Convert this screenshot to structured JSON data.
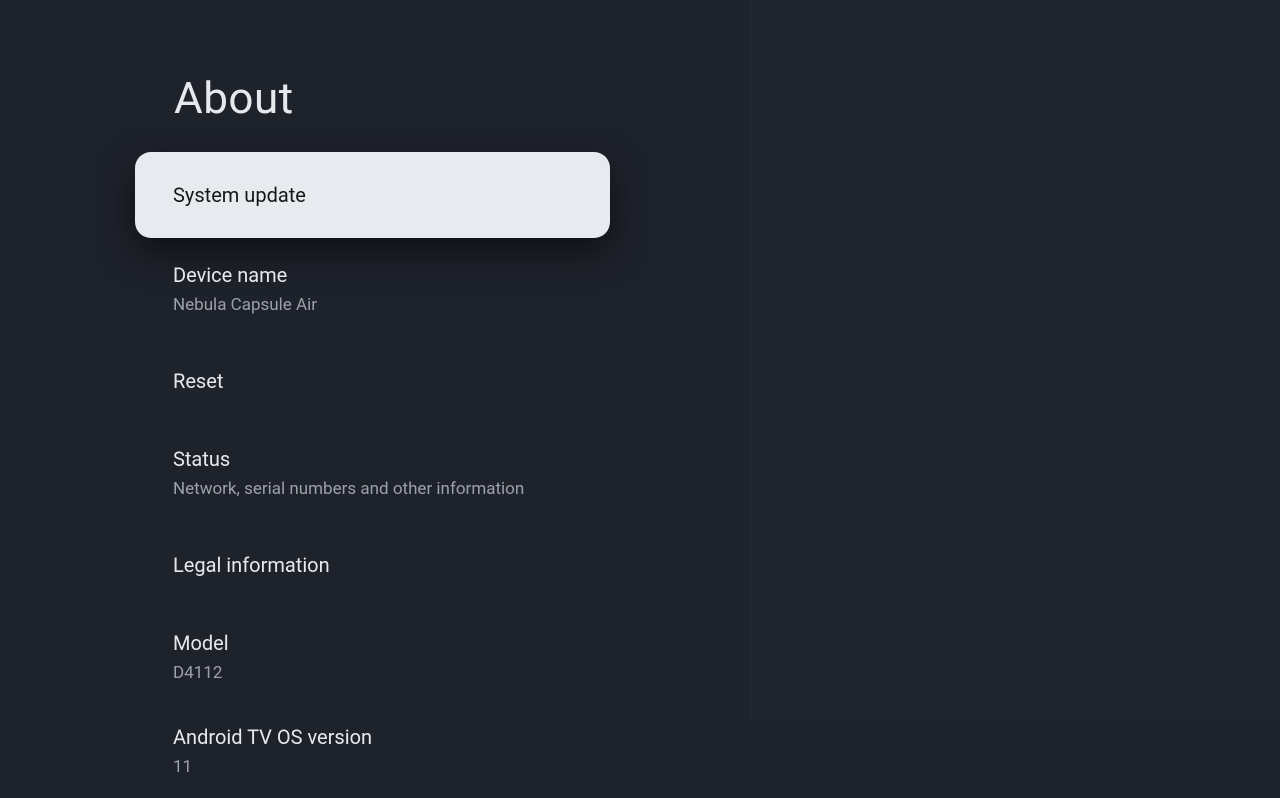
{
  "page": {
    "title": "About"
  },
  "items": [
    {
      "title": "System update",
      "subtitle": null,
      "focused": true
    },
    {
      "title": "Device name",
      "subtitle": "Nebula Capsule Air",
      "focused": false
    },
    {
      "title": "Reset",
      "subtitle": null,
      "focused": false
    },
    {
      "title": "Status",
      "subtitle": "Network, serial numbers and other information",
      "focused": false
    },
    {
      "title": "Legal information",
      "subtitle": null,
      "focused": false
    },
    {
      "title": "Model",
      "subtitle": "D4112",
      "focused": false
    },
    {
      "title": "Android TV OS version",
      "subtitle": "11",
      "focused": false
    }
  ]
}
